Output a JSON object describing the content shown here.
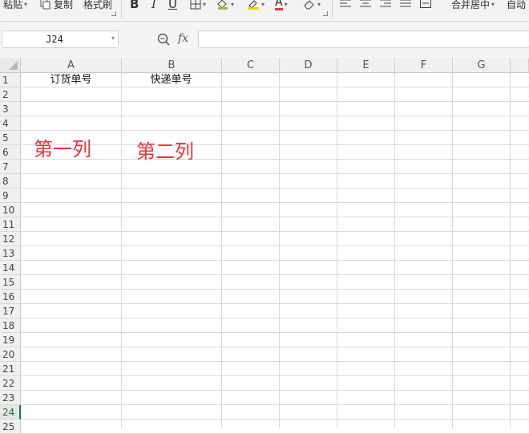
{
  "ribbon": {
    "paste_label": "粘贴",
    "copy_label": "复制",
    "format_painter_label": "格式刷",
    "bold_label": "B",
    "italic_label": "I",
    "underline_label": "U",
    "font_color_label": "A",
    "merge_center_label": "合并居中",
    "auto_wrap_label": "自动"
  },
  "formula_bar": {
    "name_box": "J24",
    "fx_label": "fx",
    "formula_value": ""
  },
  "columns": [
    "A",
    "B",
    "C",
    "D",
    "E",
    "F",
    "G"
  ],
  "rows": [
    "1",
    "2",
    "3",
    "4",
    "5",
    "6",
    "7",
    "8",
    "9",
    "10",
    "11",
    "12",
    "13",
    "14",
    "15",
    "16",
    "17",
    "18",
    "19",
    "20",
    "21",
    "22",
    "23",
    "24",
    "25"
  ],
  "active_row": "24",
  "cells": {
    "A1": "订货单号",
    "B1": "快递单号"
  },
  "annotations": {
    "col1": "第一列",
    "col2": "第二列"
  },
  "colors": {
    "annotation": "#e8343a",
    "active_row": "#217346"
  }
}
